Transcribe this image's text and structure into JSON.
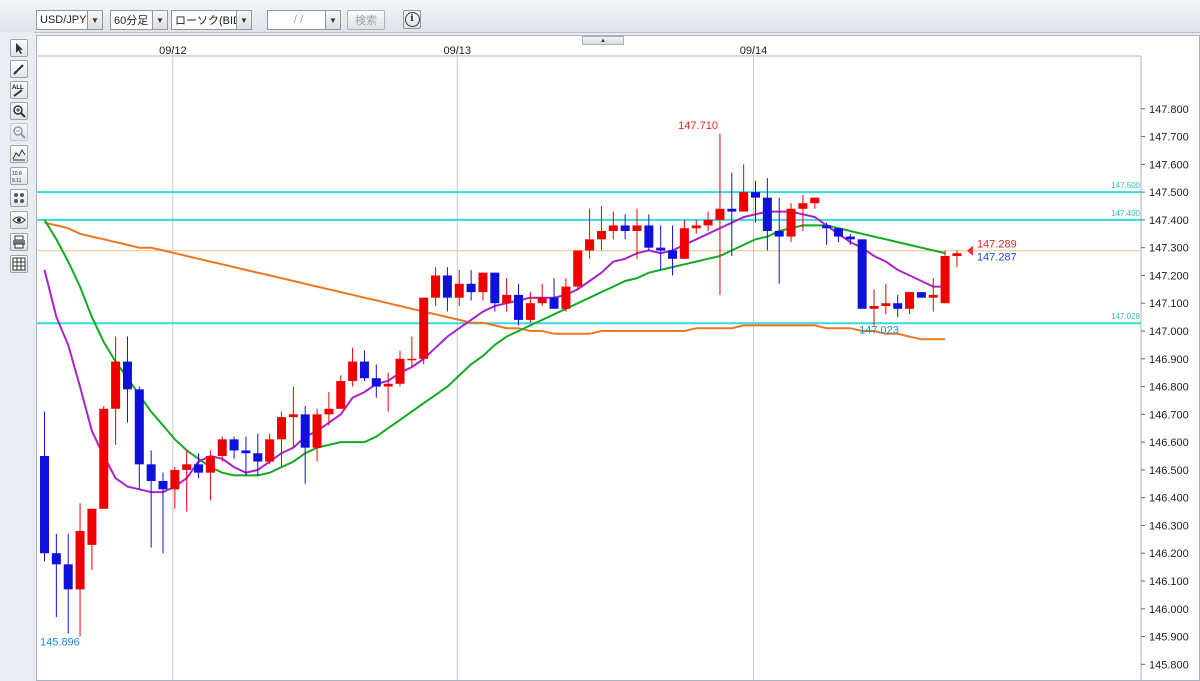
{
  "toolbar": {
    "symbol": "USD/JPY",
    "timeframe": "60分足",
    "chart_type": "ローソク(BID)",
    "date_input": "/ /",
    "search_label": "検索",
    "info_label": "i"
  },
  "tools": [
    "cursor-icon",
    "pencil-icon",
    "erase-all-icon",
    "zoom-in-icon",
    "zoom-out-icon",
    "indicator-icon",
    "price-table-icon",
    "trend-icon",
    "eye-icon",
    "print-icon",
    "settings-icon"
  ],
  "colors": {
    "up": "#ee0000",
    "down": "#1010dd",
    "ma_short": "#aa22cc",
    "ma_mid": "#11aa22",
    "ma_long": "#ee7722",
    "hline": "#33dddd",
    "price_marker": "#e03030"
  },
  "chart_data": {
    "type": "candlestick",
    "title": "",
    "xlabel": "",
    "ylabel": "",
    "ylim": [
      145.74,
      147.99
    ],
    "y_ticks": [
      "147.800",
      "147.700",
      "147.600",
      "147.500",
      "147.400",
      "147.300",
      "147.200",
      "147.100",
      "147.000",
      "146.900",
      "146.800",
      "146.700",
      "146.600",
      "146.500",
      "146.400",
      "146.300",
      "146.200",
      "146.100",
      "146.000",
      "145.900",
      "145.800",
      "145.700"
    ],
    "x_date_labels": [
      {
        "label": "09/12",
        "index": 11
      },
      {
        "label": "09/13",
        "index": 35
      },
      {
        "label": "09/14",
        "index": 60
      }
    ],
    "candles": [
      [
        146.55,
        146.71,
        146.17,
        146.2
      ],
      [
        146.2,
        146.27,
        145.97,
        146.16
      ],
      [
        146.16,
        146.27,
        145.91,
        146.07
      ],
      [
        146.07,
        146.38,
        145.9,
        146.28
      ],
      [
        146.23,
        146.36,
        146.14,
        146.36
      ],
      [
        146.36,
        146.73,
        146.36,
        146.72
      ],
      [
        146.72,
        146.98,
        146.59,
        146.89
      ],
      [
        146.89,
        146.98,
        146.67,
        146.79
      ],
      [
        146.79,
        146.8,
        146.43,
        146.52
      ],
      [
        146.52,
        146.57,
        146.22,
        146.46
      ],
      [
        146.46,
        146.49,
        146.2,
        146.43
      ],
      [
        146.43,
        146.51,
        146.36,
        146.5
      ],
      [
        146.5,
        146.57,
        146.35,
        146.52
      ],
      [
        146.52,
        146.56,
        146.47,
        146.49
      ],
      [
        146.49,
        146.57,
        146.39,
        146.55
      ],
      [
        146.55,
        146.62,
        146.53,
        146.61
      ],
      [
        146.61,
        146.62,
        146.54,
        146.57
      ],
      [
        146.57,
        146.62,
        146.48,
        146.56
      ],
      [
        146.56,
        146.63,
        146.48,
        146.53
      ],
      [
        146.53,
        146.63,
        146.52,
        146.61
      ],
      [
        146.61,
        146.71,
        146.51,
        146.69
      ],
      [
        146.69,
        146.8,
        146.58,
        146.7
      ],
      [
        146.7,
        146.73,
        146.45,
        146.58
      ],
      [
        146.58,
        146.72,
        146.53,
        146.7
      ],
      [
        146.7,
        146.78,
        146.66,
        146.72
      ],
      [
        146.72,
        146.84,
        146.72,
        146.82
      ],
      [
        146.82,
        146.94,
        146.8,
        146.89
      ],
      [
        146.89,
        146.93,
        146.82,
        146.83
      ],
      [
        146.83,
        146.88,
        146.76,
        146.8
      ],
      [
        146.8,
        146.85,
        146.71,
        146.81
      ],
      [
        146.81,
        146.93,
        146.8,
        146.9
      ],
      [
        146.9,
        146.98,
        146.87,
        146.9
      ],
      [
        146.9,
        147.12,
        146.88,
        147.12
      ],
      [
        147.12,
        147.23,
        147.09,
        147.2
      ],
      [
        147.2,
        147.23,
        147.07,
        147.12
      ],
      [
        147.12,
        147.22,
        147.09,
        147.17
      ],
      [
        147.17,
        147.22,
        147.11,
        147.14
      ],
      [
        147.14,
        147.21,
        147.11,
        147.21
      ],
      [
        147.21,
        147.21,
        147.07,
        147.1
      ],
      [
        147.1,
        147.19,
        147.07,
        147.13
      ],
      [
        147.13,
        147.17,
        147.02,
        147.04
      ],
      [
        147.04,
        147.14,
        147.03,
        147.1
      ],
      [
        147.1,
        147.17,
        147.09,
        147.12
      ],
      [
        147.12,
        147.19,
        147.08,
        147.08
      ],
      [
        147.08,
        147.19,
        147.07,
        147.16
      ],
      [
        147.16,
        147.29,
        147.15,
        147.29
      ],
      [
        147.29,
        147.44,
        147.26,
        147.33
      ],
      [
        147.33,
        147.45,
        147.29,
        147.36
      ],
      [
        147.36,
        147.43,
        147.33,
        147.38
      ],
      [
        147.38,
        147.42,
        147.33,
        147.36
      ],
      [
        147.36,
        147.44,
        147.26,
        147.38
      ],
      [
        147.38,
        147.42,
        147.29,
        147.3
      ],
      [
        147.3,
        147.38,
        147.22,
        147.29
      ],
      [
        147.29,
        147.38,
        147.2,
        147.26
      ],
      [
        147.26,
        147.4,
        147.26,
        147.37
      ],
      [
        147.37,
        147.4,
        147.35,
        147.38
      ],
      [
        147.38,
        147.43,
        147.36,
        147.4
      ],
      [
        147.4,
        147.71,
        147.13,
        147.44
      ],
      [
        147.44,
        147.57,
        147.27,
        147.43
      ],
      [
        147.43,
        147.6,
        147.43,
        147.5
      ],
      [
        147.5,
        147.54,
        147.39,
        147.48
      ],
      [
        147.48,
        147.55,
        147.29,
        147.36
      ],
      [
        147.36,
        147.48,
        147.17,
        147.34
      ],
      [
        147.34,
        147.46,
        147.32,
        147.44
      ],
      [
        147.44,
        147.49,
        147.36,
        147.46
      ],
      [
        147.46,
        147.48,
        147.44,
        147.48
      ],
      [
        147.38,
        147.39,
        147.31,
        147.37
      ],
      [
        147.37,
        147.37,
        147.32,
        147.34
      ],
      [
        147.34,
        147.35,
        147.31,
        147.33
      ],
      [
        147.33,
        147.33,
        147.08,
        147.08
      ],
      [
        147.08,
        147.15,
        147.02,
        147.09
      ],
      [
        147.09,
        147.17,
        147.06,
        147.1
      ],
      [
        147.1,
        147.13,
        147.05,
        147.08
      ],
      [
        147.08,
        147.14,
        147.06,
        147.14
      ],
      [
        147.14,
        147.14,
        147.12,
        147.12
      ],
      [
        147.12,
        147.19,
        147.07,
        147.13
      ],
      [
        147.1,
        147.29,
        147.1,
        147.27
      ],
      [
        147.27,
        147.29,
        147.23,
        147.28
      ]
    ],
    "series": [
      {
        "name": "",
        "values": [
          147.22,
          147.05,
          146.95,
          146.8,
          146.64,
          146.55,
          146.47,
          146.44,
          146.43,
          146.42,
          146.42,
          146.44,
          146.47,
          146.53,
          146.55,
          146.54,
          146.51,
          146.49,
          146.5,
          146.53,
          146.56,
          146.58,
          146.62,
          146.64,
          146.67,
          146.7,
          146.76,
          146.78,
          146.81,
          146.82,
          146.85,
          146.87,
          146.9,
          146.94,
          146.98,
          147.01,
          147.04,
          147.07,
          147.09,
          147.1,
          147.11,
          147.12,
          147.12,
          147.12,
          147.13,
          147.15,
          147.18,
          147.21,
          147.25,
          147.26,
          147.28,
          147.29,
          147.28,
          147.29,
          147.31,
          147.33,
          147.35,
          147.37,
          147.39,
          147.41,
          147.42,
          147.43,
          147.43,
          147.43,
          147.42,
          147.41,
          147.38,
          147.35,
          147.32,
          147.3,
          147.27,
          147.25,
          147.22,
          147.2,
          147.18,
          147.16,
          147.16
        ]
      },
      {
        "name": "",
        "values": [
          147.4,
          147.33,
          147.25,
          147.16,
          147.05,
          146.96,
          146.89,
          146.83,
          146.77,
          146.71,
          146.66,
          146.61,
          146.57,
          146.54,
          146.51,
          146.49,
          146.48,
          146.48,
          146.48,
          146.49,
          146.51,
          146.53,
          146.56,
          146.58,
          146.59,
          146.6,
          146.6,
          146.6,
          146.62,
          146.65,
          146.68,
          146.71,
          146.74,
          146.77,
          146.8,
          146.84,
          146.88,
          146.91,
          146.95,
          146.98,
          147.0,
          147.02,
          147.04,
          147.06,
          147.08,
          147.1,
          147.12,
          147.14,
          147.16,
          147.18,
          147.19,
          147.21,
          147.22,
          147.23,
          147.24,
          147.25,
          147.26,
          147.27,
          147.29,
          147.31,
          147.33,
          147.34,
          147.36,
          147.37,
          147.38,
          147.38,
          147.38,
          147.37,
          147.36,
          147.35,
          147.34,
          147.33,
          147.32,
          147.31,
          147.3,
          147.29,
          147.28
        ]
      },
      {
        "name": "",
        "values": [
          147.39,
          147.38,
          147.37,
          147.35,
          147.34,
          147.33,
          147.32,
          147.31,
          147.3,
          147.3,
          147.29,
          147.28,
          147.27,
          147.26,
          147.25,
          147.24,
          147.23,
          147.22,
          147.21,
          147.2,
          147.19,
          147.18,
          147.17,
          147.16,
          147.15,
          147.14,
          147.13,
          147.12,
          147.11,
          147.1,
          147.09,
          147.08,
          147.07,
          147.06,
          147.05,
          147.04,
          147.03,
          147.03,
          147.02,
          147.01,
          147.01,
          147.0,
          147.0,
          146.99,
          146.99,
          146.99,
          146.99,
          147.0,
          147.0,
          147.0,
          147.0,
          147.0,
          147.0,
          147.0,
          147.0,
          147.01,
          147.01,
          147.01,
          147.01,
          147.02,
          147.02,
          147.02,
          147.02,
          147.02,
          147.02,
          147.02,
          147.01,
          147.01,
          147.01,
          147.0,
          147.0,
          146.99,
          146.99,
          146.98,
          146.97,
          146.97,
          146.97
        ]
      }
    ],
    "horizontal_lines": [
      {
        "value": 147.5,
        "label": "147.500"
      },
      {
        "value": 147.4,
        "label": "147.400"
      },
      {
        "value": 147.028,
        "label": "147.028"
      }
    ],
    "reference_line": 147.289,
    "annotations": {
      "high_label": "147.710",
      "low_label": "145.896",
      "recent_low_label": "147.023",
      "bid_label": "147.289",
      "ask_label": "147.287"
    }
  }
}
